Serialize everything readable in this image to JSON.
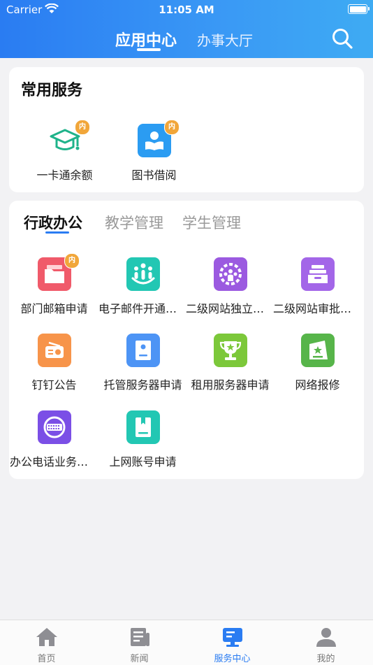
{
  "status_bar": {
    "carrier": "Carrier",
    "time": "11:05 AM"
  },
  "header": {
    "tabs": [
      {
        "label": "应用中心",
        "active": true
      },
      {
        "label": "办事大厅",
        "active": false
      }
    ],
    "search_icon": "search-icon"
  },
  "common_services": {
    "title": "常用服务",
    "items": [
      {
        "label": "一卡通余额",
        "icon": "graduation-cap-icon",
        "badge": "内",
        "color": "#1fb38a"
      },
      {
        "label": "图书借阅",
        "icon": "reader-book-icon",
        "badge": "内",
        "color": "#2b9cf2"
      }
    ]
  },
  "admin_section": {
    "tabs": [
      {
        "label": "行政办公",
        "active": true
      },
      {
        "label": "教学管理",
        "active": false
      },
      {
        "label": "学生管理",
        "active": false
      }
    ],
    "items": [
      {
        "label": "部门邮箱申请",
        "icon": "folder-icon",
        "badge": "内",
        "color": "#f05a6a"
      },
      {
        "label": "电子邮件开通申请",
        "icon": "team-icon",
        "badge": "",
        "color": "#22c7b3"
      },
      {
        "label": "二级网站独立建站申请",
        "icon": "gear-people-icon",
        "badge": "",
        "color": "#9b5ae0"
      },
      {
        "label": "二级网站审批申请",
        "icon": "inbox-icon",
        "badge": "",
        "color": "#a366e8"
      },
      {
        "label": "钉钉公告",
        "icon": "radio-icon",
        "badge": "",
        "color": "#f7944a"
      },
      {
        "label": "托管服务器申请",
        "icon": "server-icon",
        "badge": "",
        "color": "#4d94f5"
      },
      {
        "label": "租用服务器申请",
        "icon": "trophy-icon",
        "badge": "",
        "color": "#7cc83a"
      },
      {
        "label": "网络报修",
        "icon": "award-icon",
        "badge": "",
        "color": "#57b54a"
      },
      {
        "label": "办公电话业务申请",
        "icon": "keyboard-icon",
        "badge": "",
        "color": "#7b4fe6"
      },
      {
        "label": "上网账号申请",
        "icon": "book-icon",
        "badge": "",
        "color": "#22c7b3"
      }
    ]
  },
  "tabbar": {
    "items": [
      {
        "label": "首页",
        "icon": "home-icon",
        "active": false
      },
      {
        "label": "新闻",
        "icon": "news-icon",
        "active": false
      },
      {
        "label": "服务中心",
        "icon": "service-center-icon",
        "active": true
      },
      {
        "label": "我的",
        "icon": "profile-icon",
        "active": false
      }
    ]
  }
}
